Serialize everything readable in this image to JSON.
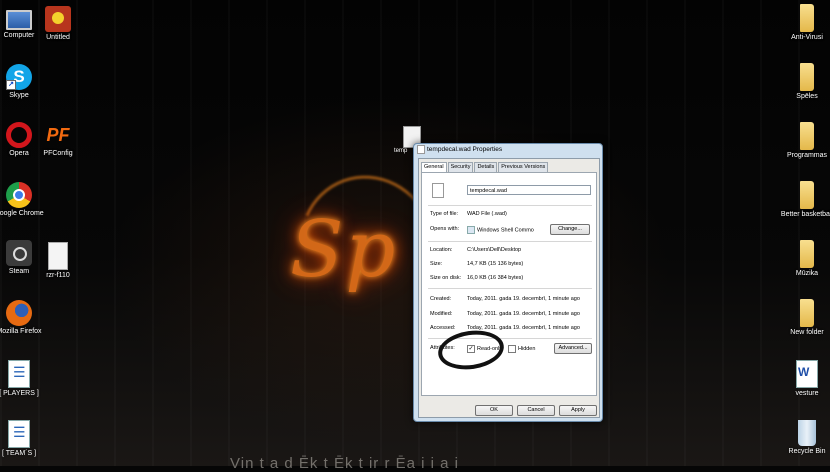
{
  "desktop": {
    "left_icons": [
      {
        "name": "computer",
        "label": "Computer"
      },
      {
        "name": "untitled",
        "label": "Untitled"
      },
      {
        "name": "skype",
        "label": "Skype"
      },
      {
        "name": "opera",
        "label": "Opera"
      },
      {
        "name": "pfconfig",
        "label": "PFConfig"
      },
      {
        "name": "chrome",
        "label": "Google Chrome"
      },
      {
        "name": "steam",
        "label": "Steam"
      },
      {
        "name": "rzr",
        "label": "rzr-f110"
      },
      {
        "name": "firefox",
        "label": "Mozilla Firefox"
      },
      {
        "name": "players",
        "label": "[ PLAYERS ]"
      },
      {
        "name": "team",
        "label": "[ TEAM´S ]"
      }
    ],
    "right_icons": [
      {
        "name": "anti-virusi",
        "label": "Anti-Virusi"
      },
      {
        "name": "speles",
        "label": "Spēles"
      },
      {
        "name": "programmas",
        "label": "Programmas"
      },
      {
        "name": "better-basketball",
        "label": "Better basketball"
      },
      {
        "name": "muzika",
        "label": "Mūzika"
      },
      {
        "name": "new-folder",
        "label": "New folder"
      },
      {
        "name": "vesture",
        "label": "vesture"
      },
      {
        "name": "recycle-bin",
        "label": "Recycle Bin"
      }
    ],
    "center_file_label": "temp",
    "wallpaper_text": "Sp",
    "bottom_text": "Vin    t   a   d   Ēk   t   Ēk   t   ir   r   Ēa   i   i   a   i"
  },
  "dialog": {
    "title": "tempdecal.wad Properties",
    "tabs": [
      "General",
      "Security",
      "Details",
      "Previous Versions"
    ],
    "filename": "tempdecal.wad",
    "type_label": "Type of file:",
    "type_value": "WAD File (.wad)",
    "opens_label": "Opens with:",
    "opens_value": "Windows Shell Commo",
    "change_label": "Change...",
    "location_label": "Location:",
    "location_value": "C:\\Users\\Dell\\Desktop",
    "size_label": "Size:",
    "size_value": "14,7 KB (15 136 bytes)",
    "size_disk_label": "Size on disk:",
    "size_disk_value": "16,0 KB (16 384 bytes)",
    "created_label": "Created:",
    "created_value": "Today, 2011. gada 19. decembrī, 1 minute ago",
    "modified_label": "Modified:",
    "modified_value": "Today, 2011. gada 19. decembrī, 1 minute ago",
    "accessed_label": "Accessed:",
    "accessed_value": "Today, 2011. gada 19. decembrī, 1 minute ago",
    "attributes_label": "Attributes:",
    "readonly_label": "Read-only",
    "readonly_checked": true,
    "hidden_label": "Hidden",
    "hidden_checked": false,
    "advanced_label": "Advanced...",
    "ok_label": "OK",
    "cancel_label": "Cancel",
    "apply_label": "Apply"
  },
  "colors": {
    "wallpaper": "#060606",
    "fire": "#e3701a",
    "dialog_frame": "#cfe0ef",
    "dialog_client": "#ebeae6"
  }
}
